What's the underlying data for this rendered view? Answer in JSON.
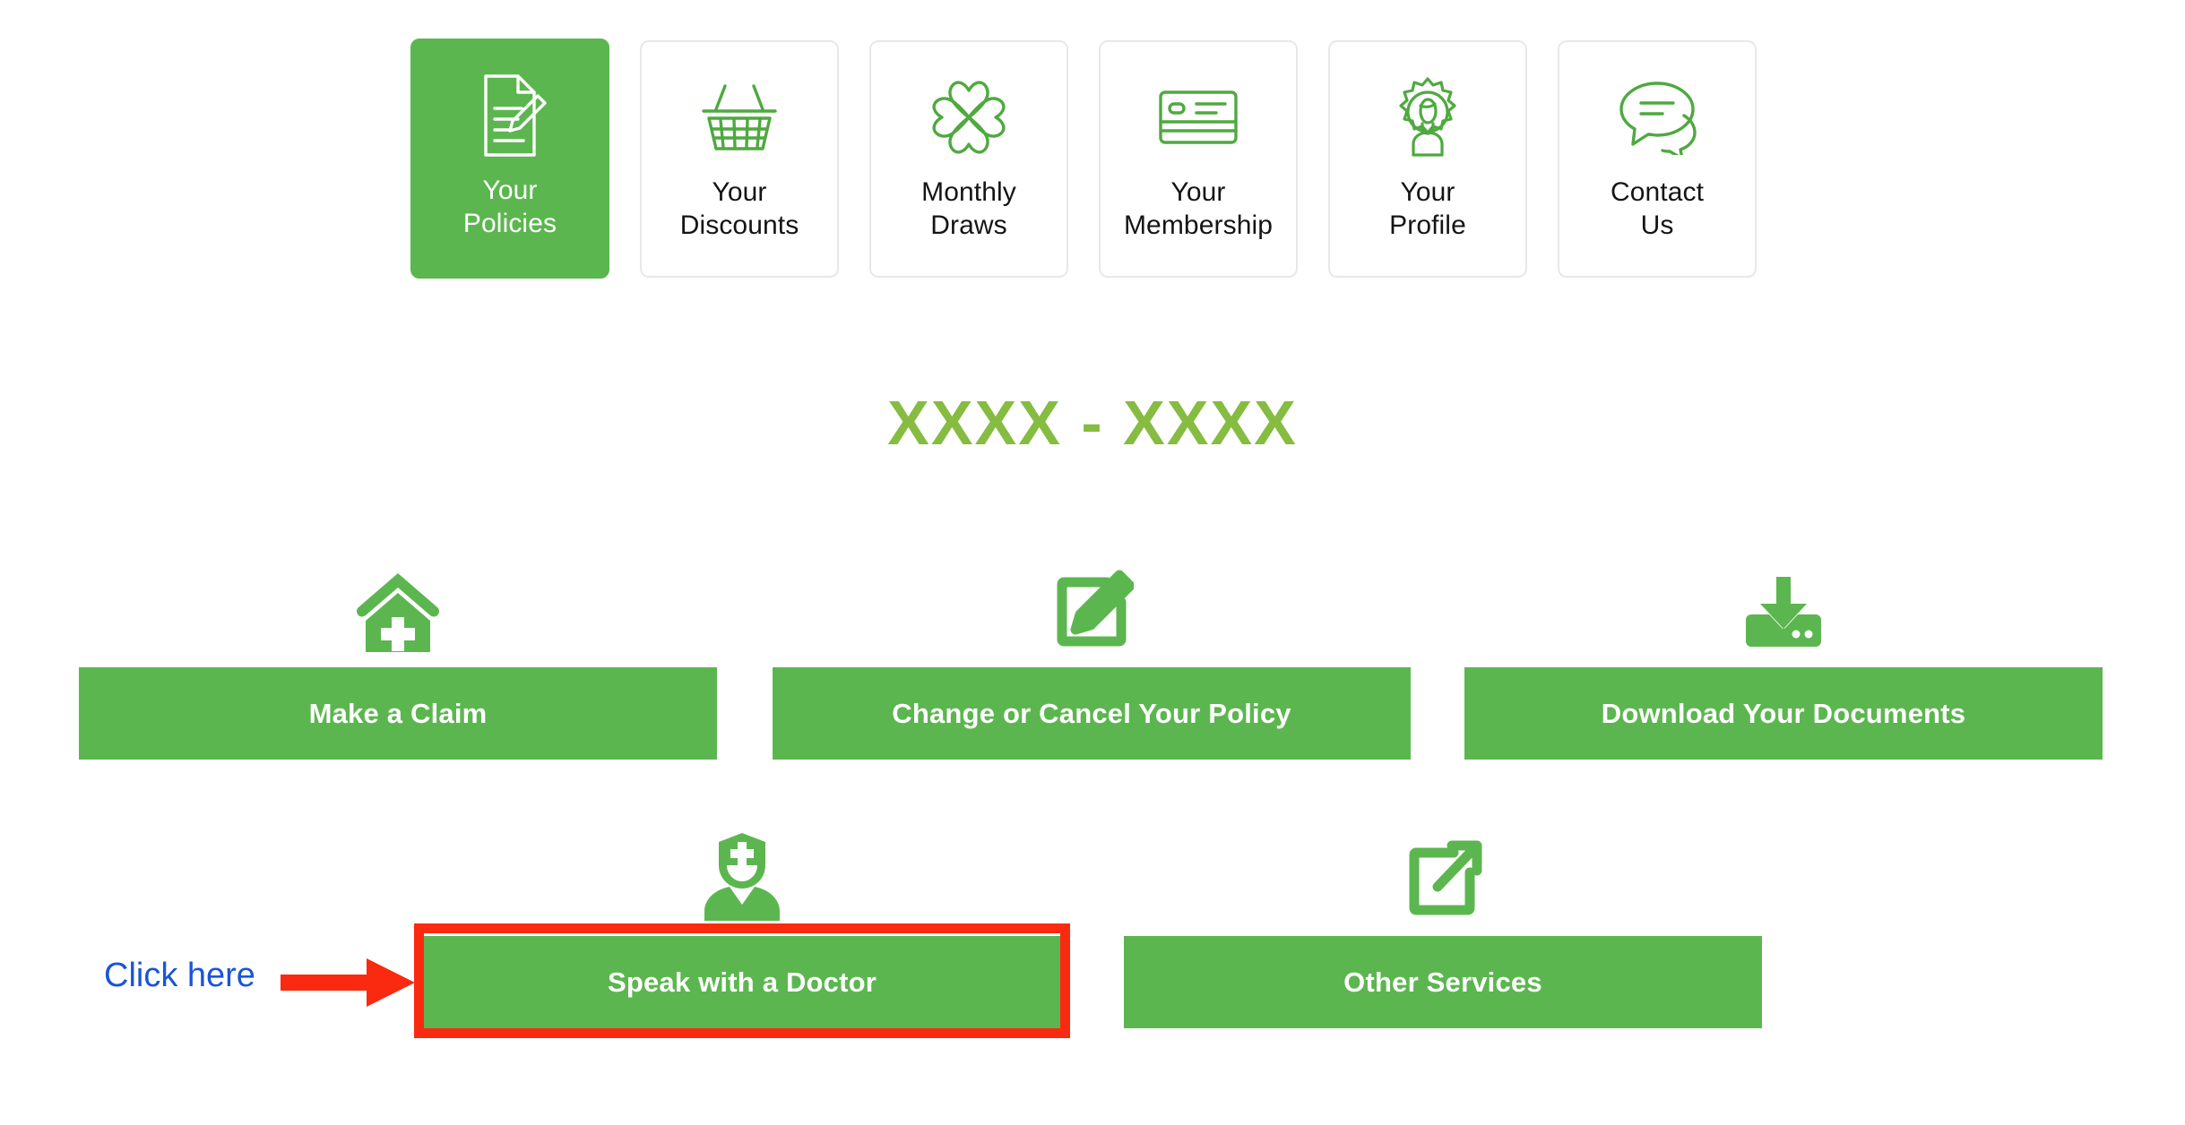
{
  "nav": {
    "tiles": [
      {
        "label": "Your\nPolicies",
        "icon": "document-pencil-icon",
        "active": true,
        "name": "nav-tile-your-policies"
      },
      {
        "label": "Your\nDiscounts",
        "icon": "shopping-basket-icon",
        "active": false,
        "name": "nav-tile-your-discounts"
      },
      {
        "label": "Monthly\nDraws",
        "icon": "four-leaf-clover-icon",
        "active": false,
        "name": "nav-tile-monthly-draws"
      },
      {
        "label": "Your\nMembership",
        "icon": "membership-card-icon",
        "active": false,
        "name": "nav-tile-your-membership"
      },
      {
        "label": "Your\nProfile",
        "icon": "profile-gear-icon",
        "active": false,
        "name": "nav-tile-your-profile"
      },
      {
        "label": "Contact\nUs",
        "icon": "speech-bubbles-icon",
        "active": false,
        "name": "nav-tile-contact-us"
      }
    ]
  },
  "policy": {
    "number": "XXXX - XXXX"
  },
  "actions": {
    "make_claim": {
      "label": "Make a Claim",
      "icon": "house-medical-cross-icon"
    },
    "change_cancel": {
      "label": "Change or Cancel Your Policy",
      "icon": "edit-square-pencil-icon"
    },
    "download_documents": {
      "label": "Download Your Documents",
      "icon": "download-tray-icon"
    },
    "speak_doctor": {
      "label": "Speak with a Doctor",
      "icon": "doctor-person-icon"
    },
    "other_services": {
      "label": "Other Services",
      "icon": "external-link-icon"
    }
  },
  "annotation": {
    "click_here_label": "Click here",
    "arrow_icon": "right-arrow-icon",
    "target": "Speak with a Doctor"
  },
  "colors": {
    "brand_green": "#5cb64f",
    "heading_green": "#85bc41",
    "tile_border": "#e6e8ea",
    "annotation_red": "#fa2a10",
    "annotation_blue": "#1b55d6",
    "button_text": "#ffffff",
    "tile_text": "#141414"
  }
}
